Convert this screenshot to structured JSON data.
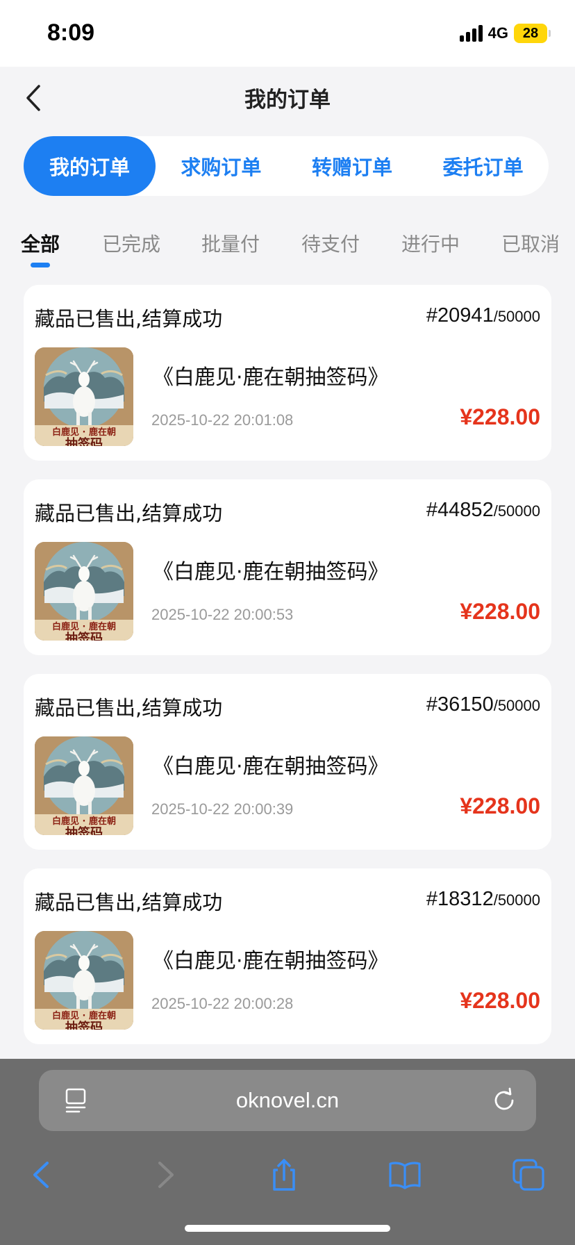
{
  "status_bar": {
    "time": "8:09",
    "network": "4G",
    "battery": "28"
  },
  "header": {
    "title": "我的订单"
  },
  "segments": [
    {
      "label": "我的订单",
      "active": true
    },
    {
      "label": "求购订单",
      "active": false
    },
    {
      "label": "转赠订单",
      "active": false
    },
    {
      "label": "委托订单",
      "active": false
    }
  ],
  "filters": [
    {
      "label": "全部",
      "active": true
    },
    {
      "label": "已完成",
      "active": false
    },
    {
      "label": "批量付",
      "active": false
    },
    {
      "label": "待支付",
      "active": false
    },
    {
      "label": "进行中",
      "active": false
    },
    {
      "label": "已取消",
      "active": false
    }
  ],
  "orders": [
    {
      "status": "藏品已售出,结算成功",
      "serial": "#20941",
      "total": "/50000",
      "name": "《白鹿见·鹿在朝抽签码》",
      "time": "2025-10-22 20:01:08",
      "price": "¥228.00",
      "thumb_caption": "白鹿见 · 鹿在朝",
      "thumb_caption2": "抽签码"
    },
    {
      "status": "藏品已售出,结算成功",
      "serial": "#44852",
      "total": "/50000",
      "name": "《白鹿见·鹿在朝抽签码》",
      "time": "2025-10-22 20:00:53",
      "price": "¥228.00",
      "thumb_caption": "白鹿见 · 鹿在朝",
      "thumb_caption2": "抽签码"
    },
    {
      "status": "藏品已售出,结算成功",
      "serial": "#36150",
      "total": "/50000",
      "name": "《白鹿见·鹿在朝抽签码》",
      "time": "2025-10-22 20:00:39",
      "price": "¥228.00",
      "thumb_caption": "白鹿见 · 鹿在朝",
      "thumb_caption2": "抽签码"
    },
    {
      "status": "藏品已售出,结算成功",
      "serial": "#18312",
      "total": "/50000",
      "name": "《白鹿见·鹿在朝抽签码》",
      "time": "2025-10-22 20:00:28",
      "price": "¥228.00",
      "thumb_caption": "白鹿见 · 鹿在朝",
      "thumb_caption2": "抽签码"
    }
  ],
  "browser": {
    "url": "oknovel.cn"
  },
  "colors": {
    "accent": "#1d7ff2",
    "price": "#e5341c"
  },
  "icons": [
    "back-icon",
    "reader-icon",
    "reload-icon",
    "back-nav-icon",
    "forward-nav-icon",
    "share-icon",
    "bookmarks-icon",
    "tabs-icon"
  ]
}
